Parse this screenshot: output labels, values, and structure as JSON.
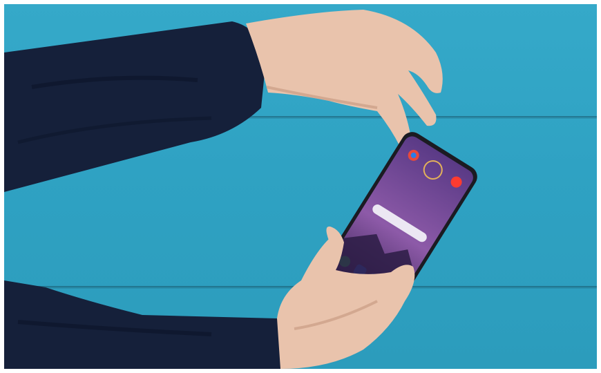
{
  "scene": {
    "description_visible_text": [],
    "colors": {
      "wall": "#2fa2c3",
      "wall_seam": "#1a5f74",
      "sleeve": "#15203a",
      "skin": "#e9c3ac",
      "phone_frame": "#1b1b22",
      "phone_screen": "#4a2f6e"
    },
    "icons": [
      "phone-icon",
      "messages-icon",
      "contacts-icon",
      "play-store-icon",
      "chrome-icon",
      "youtube-icon"
    ]
  }
}
